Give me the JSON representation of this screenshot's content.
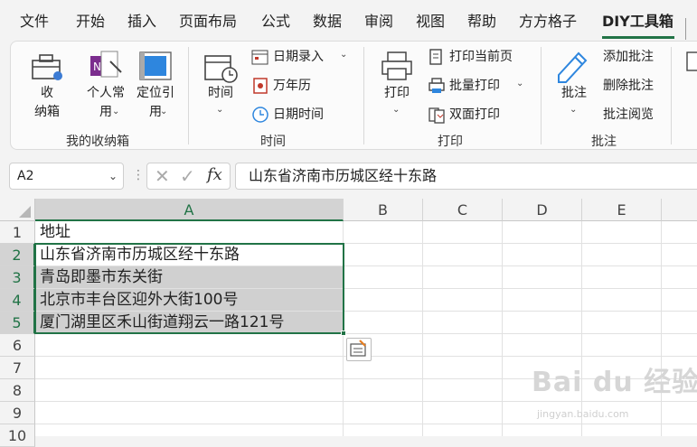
{
  "menu_tabs": [
    "文件",
    "开始",
    "插入",
    "页面布局",
    "公式",
    "数据",
    "审阅",
    "视图",
    "帮助",
    "方方格子",
    "DIY工具箱"
  ],
  "ribbon": {
    "groups": {
      "box": {
        "label": "我的收纳箱",
        "btn1": "收\n纳箱",
        "btn2": "个人常\n用",
        "btn3": "定位引\n用"
      },
      "time": {
        "label": "时间",
        "big": "时间",
        "date_entry": "日期录入",
        "calendar": "万年历",
        "datetime": "日期时间"
      },
      "print": {
        "label": "打印",
        "big": "打印",
        "current": "打印当前页",
        "batch": "批量打印",
        "duplex": "双面打印"
      },
      "comment": {
        "label": "批注",
        "big": "批注",
        "add": "添加批注",
        "delete": "删除批注",
        "review": "批注阅览"
      }
    }
  },
  "formula_bar": {
    "name_box": "A2",
    "fx": "fx",
    "content": "山东省济南市历城区经十东路"
  },
  "columns": [
    "A",
    "B",
    "C",
    "D",
    "E"
  ],
  "rows": [
    "1",
    "2",
    "3",
    "4",
    "5",
    "6",
    "7",
    "8",
    "9",
    "10"
  ],
  "cells": {
    "A1": "地址",
    "A2": "山东省济南市历城区经十东路",
    "A3": "青岛即墨市东关街",
    "A4": "北京市丰台区迎外大街100号",
    "A5": "厦门湖里区禾山街道翔云一路121号"
  },
  "watermark": {
    "main": "Bai du 经验",
    "sub": "jingyan.baidu.com"
  },
  "colors": {
    "accent": "#217346",
    "selection_shade": "#d0d0d0"
  }
}
